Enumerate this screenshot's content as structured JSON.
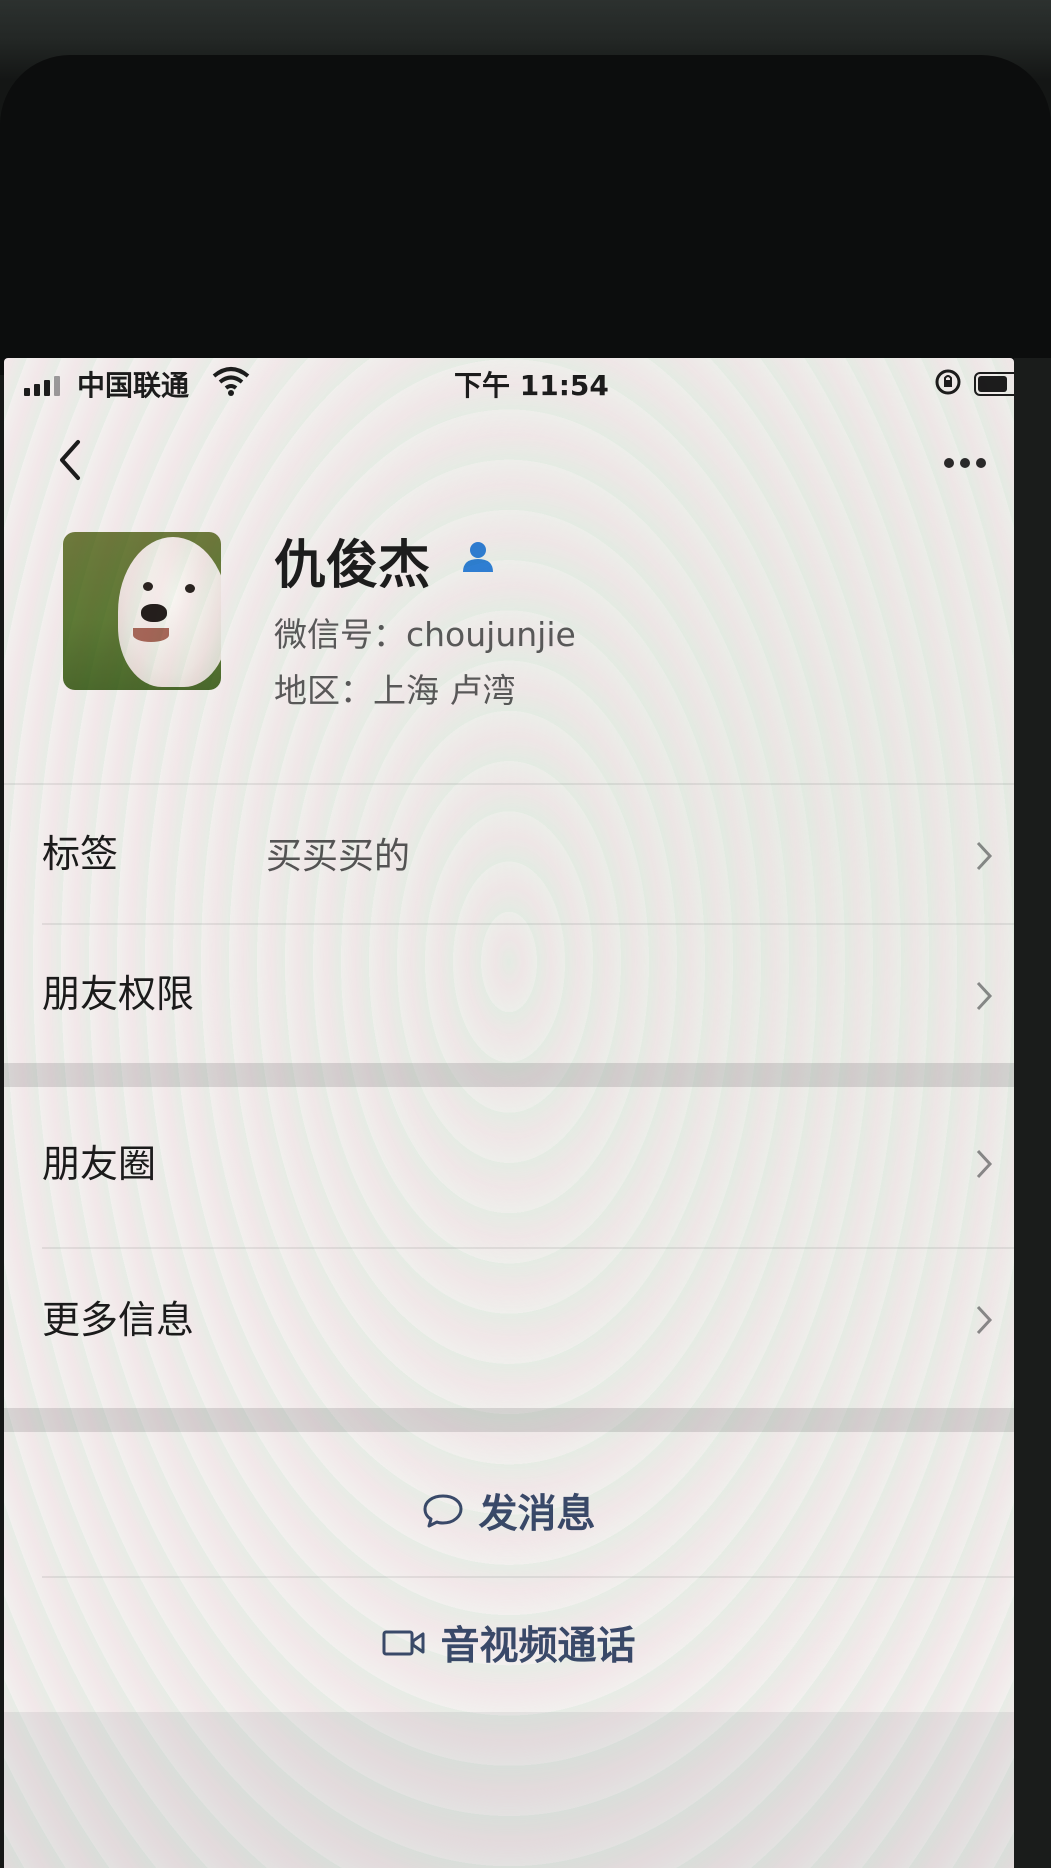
{
  "status_bar": {
    "carrier": "中国联通",
    "time": "下午 11:54",
    "battery_level": 0.6
  },
  "nav": {
    "back_icon": "chevron-left-icon",
    "more_icon": "more-dots-icon"
  },
  "profile": {
    "name": "仇俊杰",
    "wechat_id": "微信号：choujunjie",
    "region": "地区：上海 卢湾",
    "verified_icon": "person-badge-icon"
  },
  "rows": [
    {
      "label": "标签",
      "value": "买买买的"
    },
    {
      "label": "朋友权限",
      "value": ""
    },
    {
      "label": "朋友圈",
      "value": ""
    },
    {
      "label": "更多信息",
      "value": ""
    }
  ],
  "actions": {
    "message": "发消息",
    "call": "音视频通话"
  },
  "colors": {
    "action_text": "#3a4a6a",
    "verified": "#2f7fd6"
  }
}
